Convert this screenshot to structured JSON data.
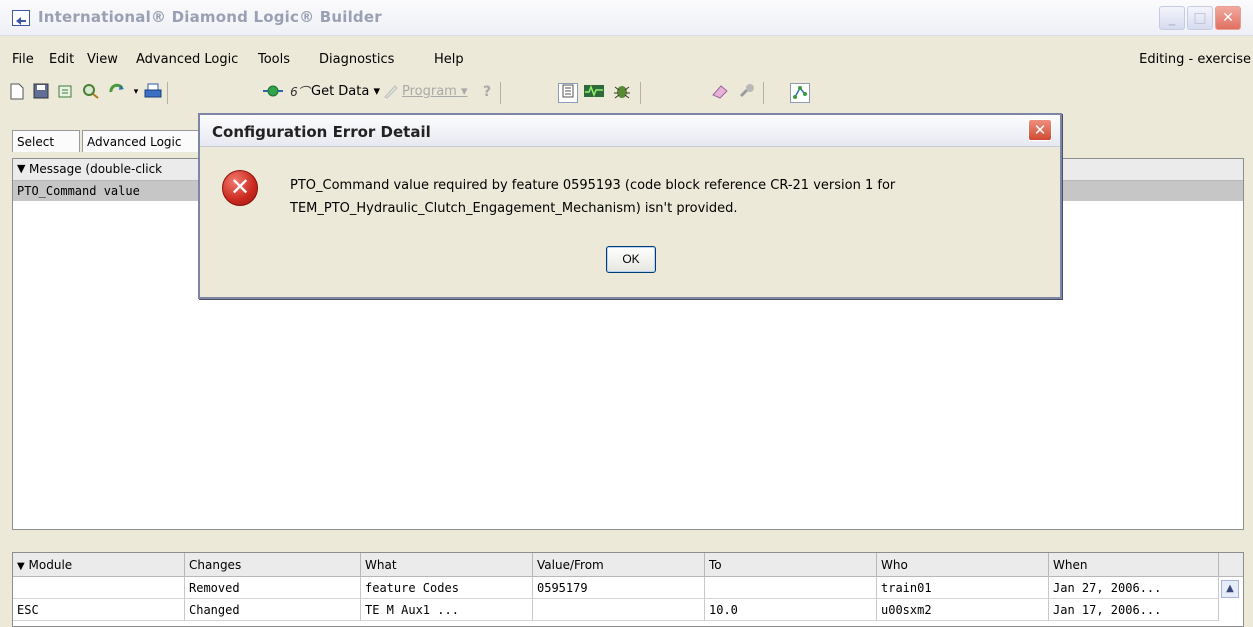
{
  "window": {
    "title": "International® Diamond Logic® Builder"
  },
  "menu": {
    "items": [
      "File",
      "Edit",
      "View",
      "Advanced Logic",
      "Tools",
      "Diagnostics",
      "Help"
    ],
    "status": "Editing - exercise"
  },
  "toolbar": {
    "get_data_label": "Get Data",
    "program_label": "Program",
    "icons": [
      "new-icon",
      "save-icon",
      "open-icon",
      "find-icon",
      "refresh-icon",
      "print-icon",
      "connect-icon",
      "get-data-icon",
      "program-icon",
      "help-icon",
      "document-icon",
      "graph-icon",
      "bug-icon",
      "eraser-icon",
      "plug-icon",
      "network-icon"
    ]
  },
  "tabs": [
    "Select",
    "Advanced Logic"
  ],
  "upper_panel": {
    "header": "Message (double-click",
    "rows": [
      "PTO_Command value"
    ]
  },
  "dialog": {
    "title": "Configuration Error Detail",
    "message_line1": "PTO_Command value required by feature 0595193 (code block reference CR-21 version 1 for",
    "message_line2": "TEM_PTO_Hydraulic_Clutch_Engagement_Mechanism) isn't provided.",
    "ok_label": "OK"
  },
  "changes_table": {
    "columns": [
      "Module",
      "Changes",
      "What",
      "Value/From",
      "To",
      "Who",
      "When"
    ],
    "rows": [
      [
        "",
        "Removed",
        "feature Codes",
        "0595179",
        "",
        "train01",
        "Jan 27, 2006..."
      ],
      [
        "ESC",
        "Changed",
        "TE M  Aux1  ...",
        "",
        "10.0",
        "u00sxm2",
        "Jan 17, 2006..."
      ]
    ]
  },
  "colors": {
    "title_inactive": "#9aa0b3",
    "selected_row": "#c6c6c6",
    "error_red": "#c9281d"
  }
}
